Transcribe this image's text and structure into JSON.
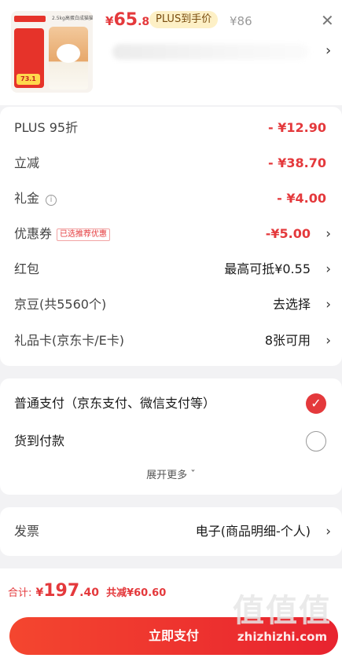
{
  "product": {
    "image_caption": "2.5kg高蛋白成猫猫粮",
    "image_tag": "73.1",
    "price_symbol": "¥",
    "price_int": "65",
    "price_dec": ".8",
    "plus_label": "PLUS到手价",
    "original_price": "¥86",
    "close_icon": "close-icon",
    "chevron": "›"
  },
  "discounts": [
    {
      "label": "PLUS 95折",
      "value": "- ¥12.90",
      "style": "red"
    },
    {
      "label": "立减",
      "value": "- ¥38.70",
      "style": "red"
    },
    {
      "label": "礼金",
      "value": "- ¥4.00",
      "style": "red",
      "info_icon": "info-icon"
    },
    {
      "label": "优惠券",
      "badge": "已选推荐优惠",
      "value": "-¥5.00",
      "style": "red",
      "arrow": "›"
    },
    {
      "label": "红包",
      "value": "最高可抵¥0.55",
      "style": "dark",
      "arrow": "›"
    },
    {
      "label": "京豆(共5560个)",
      "value": "去选择",
      "style": "dark",
      "arrow": "›"
    },
    {
      "label": "礼品卡(京东卡/E卡)",
      "value": "8张可用",
      "style": "dark",
      "arrow": "›"
    }
  ],
  "payment": {
    "options": [
      {
        "label": "普通支付（京东支付、微信支付等）",
        "selected": true
      },
      {
        "label": "货到付款",
        "selected": false
      }
    ],
    "expand_label": "展开更多 ˇ"
  },
  "invoice": {
    "label": "发票",
    "value": "电子(商品明细-个人)",
    "arrow": "›"
  },
  "footer": {
    "total_label": "合计:",
    "total_symbol": "¥",
    "total_int": "197",
    "total_dec": ".40",
    "saved": "共减¥60.60",
    "pay_button": "立即支付",
    "watermark_big": "值值值",
    "watermark_small": "zhizhizhi.com"
  },
  "colors": {
    "accent": "#e4393c",
    "plus_pill_bg": "#fdf0c6",
    "page_bg": "#f2f2f4"
  }
}
